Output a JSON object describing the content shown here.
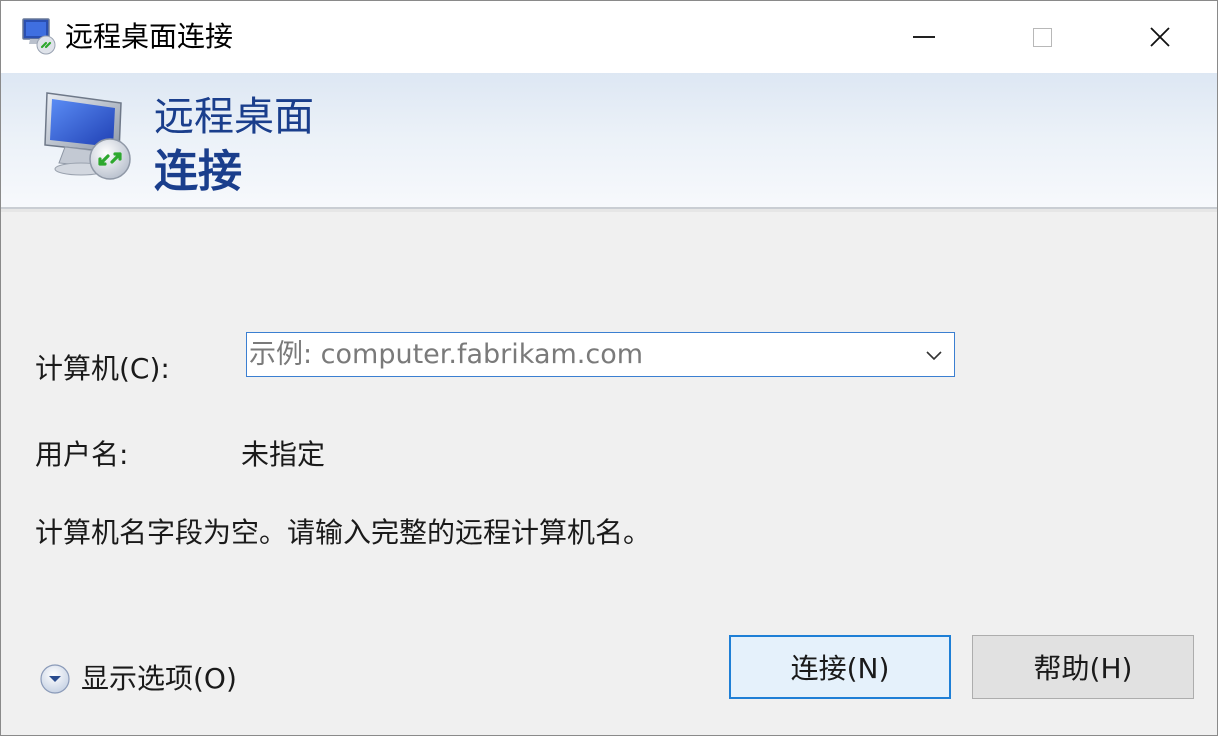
{
  "window": {
    "title": "远程桌面连接",
    "app_icon": "remote-desktop-icon",
    "controls": {
      "minimize": "minimize-icon",
      "maximize": "maximize-icon",
      "close": "close-icon"
    }
  },
  "banner": {
    "line1": "远程桌面",
    "line2": "连接",
    "icon": "remote-desktop-monitor-icon",
    "text_color": "#1a3e8c"
  },
  "form": {
    "computer_label": "计算机(C):",
    "computer_placeholder": "示例: computer.fabrikam.com",
    "computer_value": "",
    "username_label": "用户名:",
    "username_value": "未指定",
    "message": "计算机名字段为空。请输入完整的远程计算机名。"
  },
  "footer": {
    "show_options_label": "显示选项(O)",
    "show_options_icon": "chevron-down-circle-icon",
    "connect_label": "连接(N)",
    "help_label": "帮助(H)",
    "accent_color": "#1e7fd6"
  }
}
